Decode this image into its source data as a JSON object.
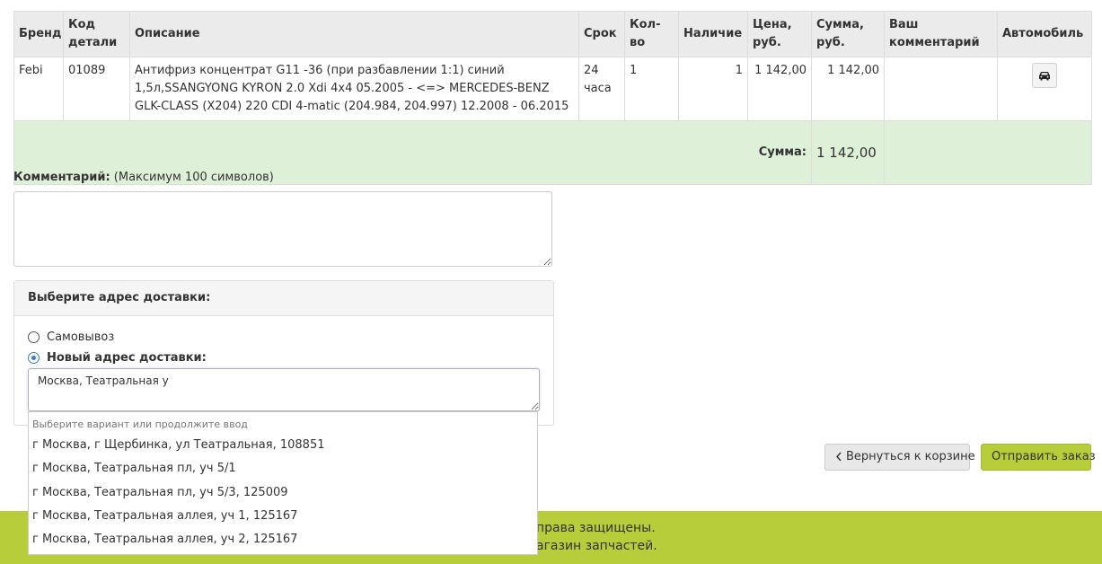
{
  "cart": {
    "headers": [
      "Бренд",
      "Код детали",
      "Описание",
      "Срок",
      "Кол-во",
      "Наличие",
      "Цена, руб.",
      "Сумма, руб.",
      "Ваш комментарий",
      "Автомобиль"
    ],
    "rows": [
      {
        "brand": "Febi",
        "code": "01089",
        "description": "Антифриз концентрат G11 -36 (при разбавлении 1:1) синий 1,5л,SSANGYONG KYRON 2.0 Xdi 4x4 05.2005 - <=> MERCEDES-BENZ GLK-CLASS (X204) 220 CDI 4-matic (204.984, 204.997) 12.2008 - 06.2015",
        "term": "24 часа",
        "qty": "1",
        "stock": "1",
        "price": "1 142,00",
        "sum": "1 142,00",
        "comment": "",
        "car_icon": "car-icon"
      }
    ],
    "total_label": "Сумма:",
    "total_value": "1 142,00"
  },
  "comment": {
    "label": "Комментарий:",
    "hint": "(Максимум 100 символов)",
    "value": ""
  },
  "delivery": {
    "title": "Выберите адрес доставки:",
    "option_pickup": "Самовывоз",
    "option_new": "Новый адрес доставки:",
    "selected": "new",
    "address_value": "Москва, Театральная у",
    "suggest_hint": "Выберите вариант или продолжите ввод",
    "suggestions": [
      "г Москва, г Щербинка, ул Театральная, 108851",
      "г Москва, Театральная пл, уч 5/1",
      "г Москва, Театральная пл, уч 5/3, 125009",
      "г Москва, Театральная аллея, уч 1, 125167",
      "г Москва, Театральная аллея, уч 2, 125167"
    ]
  },
  "buttons": {
    "back": "Вернуться к корзине",
    "back_icon": "chevron-left-icon",
    "send": "Отправить заказ"
  },
  "footer": {
    "line1": "права защищены.",
    "line2": "агазин запчастей."
  },
  "colors": {
    "accent": "#b7ce3a",
    "total_row": "#dff0d8",
    "header_bg": "#ebebeb"
  }
}
